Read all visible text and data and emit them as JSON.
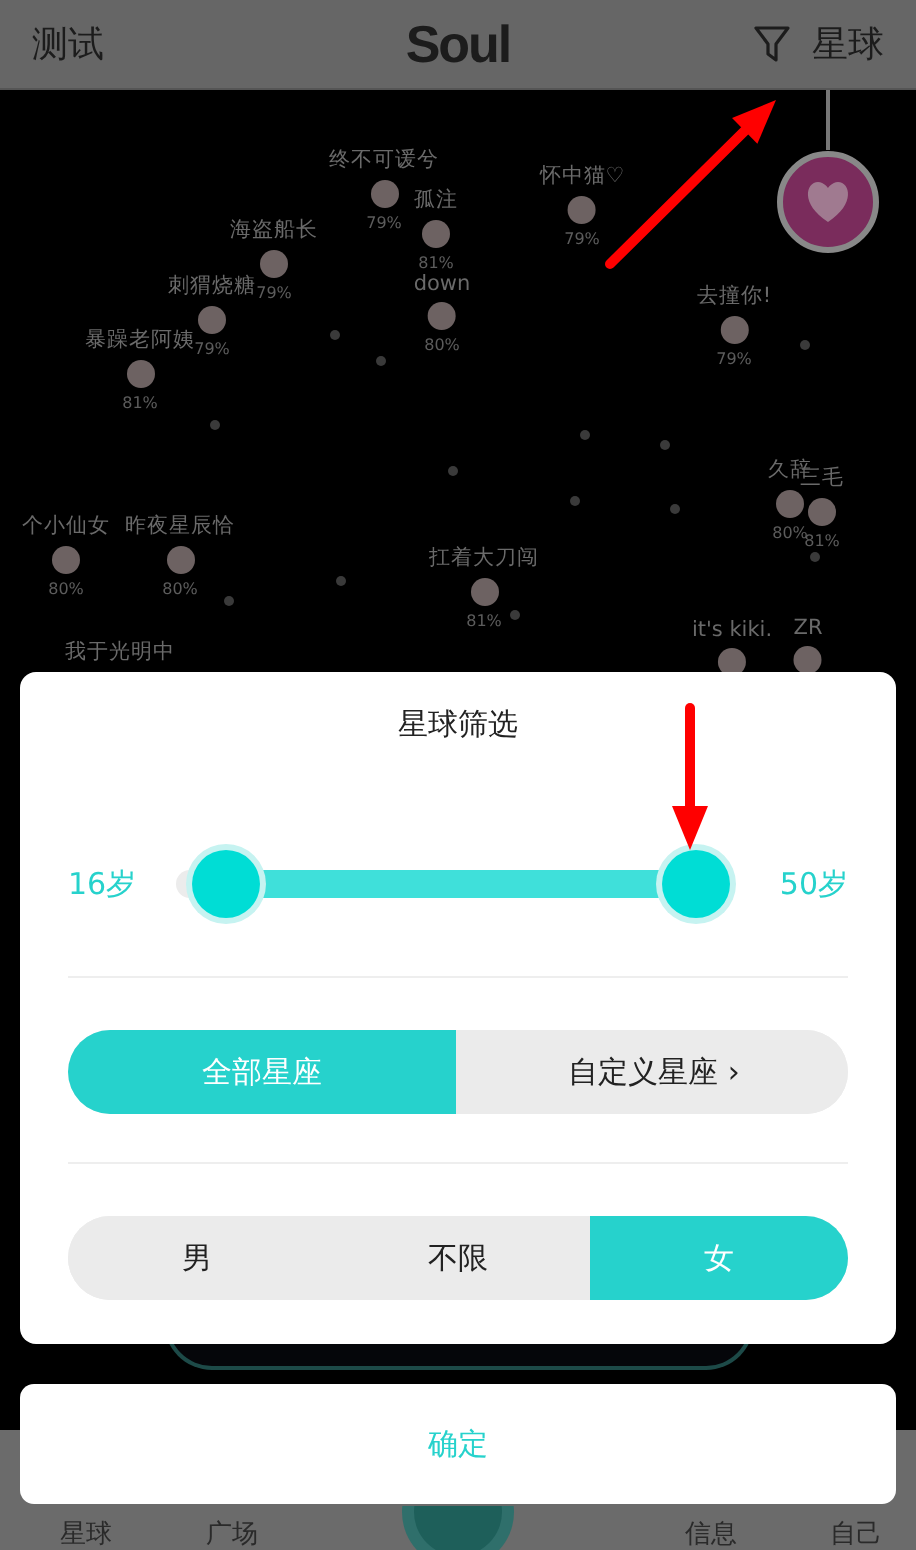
{
  "header": {
    "left": "测试",
    "title": "Soul",
    "right": "星球"
  },
  "planets": [
    {
      "name": "终不可谖兮",
      "match": "79%"
    },
    {
      "name": "孤注",
      "match": "81%"
    },
    {
      "name": "海盗船长",
      "match": "79%"
    },
    {
      "name": "怀中猫♡",
      "match": "79%"
    },
    {
      "name": "刺猬烧糖",
      "match": "79%"
    },
    {
      "name": "down",
      "match": "80%"
    },
    {
      "name": "去撞你!",
      "match": "79%"
    },
    {
      "name": "暴躁老阿姨",
      "match": "81%"
    },
    {
      "name": "个小仙女",
      "match": "80%"
    },
    {
      "name": "昨夜星辰恰",
      "match": "80%"
    },
    {
      "name": "扛着大刀闯",
      "match": "81%"
    },
    {
      "name": "久辞",
      "match": "80%"
    },
    {
      "name": "三毛",
      "match": "81%"
    },
    {
      "name": "it's kiki."
    },
    {
      "name": "ZR"
    },
    {
      "name": "我于光明中"
    }
  ],
  "dialog": {
    "title": "星球筛选",
    "min_label": "16岁",
    "max_label": "50岁",
    "thumbs": [
      {
        "level": 0.09
      },
      {
        "level": 0.94
      }
    ],
    "zodiac": [
      {
        "label": "全部星座",
        "selected": true
      },
      {
        "label": "自定义星座",
        "selected": false,
        "chevron": "›"
      }
    ],
    "gender": [
      {
        "label": "男",
        "selected": false
      },
      {
        "label": "不限",
        "selected": false
      },
      {
        "label": "女",
        "selected": true
      }
    ]
  },
  "confirm": "确定",
  "nav": [
    {
      "label": "星球"
    },
    {
      "label": "广场"
    },
    {
      "label": "信息"
    },
    {
      "label": "自己"
    }
  ],
  "annotations": [
    {
      "kind": "arrow"
    },
    {
      "kind": "arrow"
    }
  ]
}
